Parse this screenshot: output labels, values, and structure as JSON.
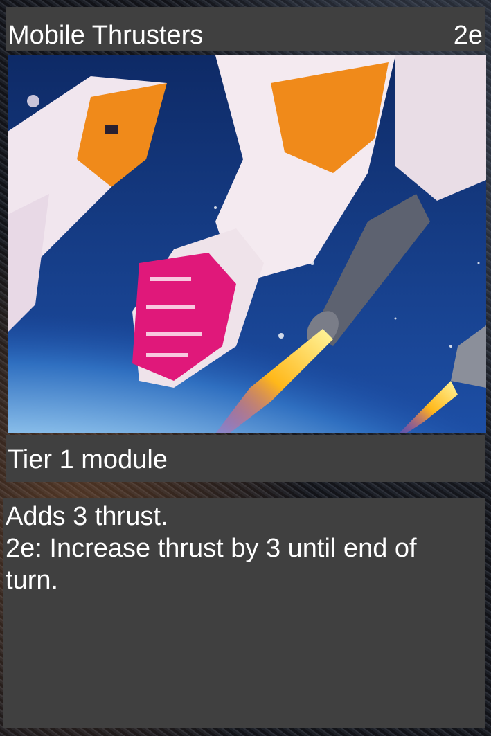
{
  "card": {
    "title": "Mobile Thrusters",
    "cost": "2e",
    "type_line": "Tier 1 module",
    "rules": [
      "Adds 3 thrust.",
      "2e: Increase thrust by 3 until end of turn."
    ]
  },
  "art": {
    "subject": "orange-white mech legs with thrusters firing in orbit above a planet",
    "colors": {
      "space": "#12306e",
      "armor_white": "#f2e8ee",
      "armor_orange": "#f08a1a",
      "boot_magenta": "#e0187a",
      "flame": "#ffc020",
      "cloud": "#e9f2fb"
    }
  },
  "theme": {
    "panel": "#404040",
    "text": "#ffffff"
  }
}
